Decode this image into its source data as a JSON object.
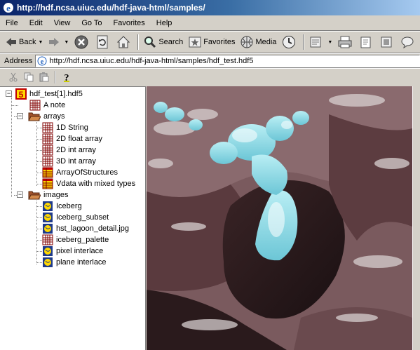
{
  "window": {
    "title": "http://hdf.ncsa.uiuc.edu/hdf-java-html/samples/"
  },
  "menu": [
    "File",
    "Edit",
    "View",
    "Go To",
    "Favorites",
    "Help"
  ],
  "toolbar": {
    "back": "Back",
    "search": "Search",
    "favorites": "Favorites",
    "media": "Media"
  },
  "address": {
    "label": "Address",
    "url": "http://hdf.ncsa.uiuc.edu/hdf-java-html/samples/hdf_test.hdf5"
  },
  "tree": {
    "root": "hdf_test[1].hdf5",
    "note": "A note",
    "arrays_group": "arrays",
    "arrays": [
      "1D String",
      "2D float array",
      "2D int array",
      "3D int array",
      "ArrayOfStructures",
      "Vdata with mixed types"
    ],
    "images_group": "images",
    "images": [
      "Iceberg",
      "Iceberg_subset",
      "hst_lagoon_detail.jpg",
      "iceberg_palette",
      "pixel interlace",
      "plane interlace"
    ]
  },
  "colors": {
    "titlebar_start": "#0a246a",
    "titlebar_end": "#a6caf0",
    "ice": "#8fd6e0",
    "land": "#7a5a5e"
  }
}
